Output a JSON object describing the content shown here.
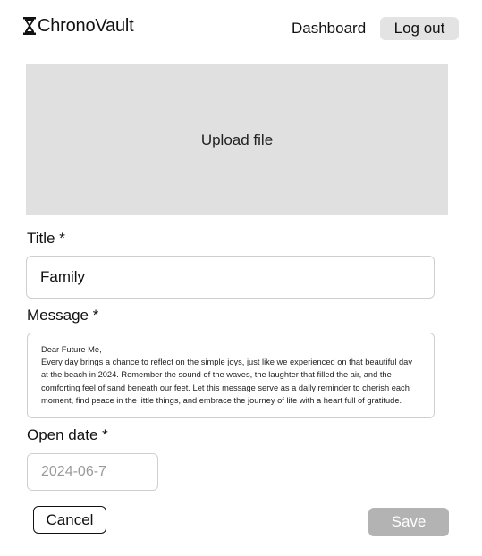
{
  "header": {
    "logo_icon": "hourglass-icon",
    "app_name": "ChronoVault",
    "nav": {
      "dashboard_label": "Dashboard",
      "logout_label": "Log out"
    }
  },
  "upload": {
    "label": "Upload file"
  },
  "form": {
    "title": {
      "label": "Title *",
      "value": "Family"
    },
    "message": {
      "label": "Message *",
      "lines": [
        "Dear Future Me,",
        "Every day brings a chance to reflect on the simple joys, just like we experienced on that beautiful day",
        "at the beach in 2024. Remember the sound of the waves, the laughter that filled the air, and the",
        "comforting feel of sand beneath our feet. Let this message serve as a daily reminder to cherish each",
        "moment, find peace in the little things, and embrace the journey of life with a heart full of gratitude."
      ]
    },
    "open_date": {
      "label": "Open date *",
      "placeholder": "2024-06-7"
    }
  },
  "actions": {
    "cancel_label": "Cancel",
    "save_label": "Save"
  },
  "colors": {
    "upload_bg": "#e0e0e0",
    "logout_bg": "#e3e3e3",
    "save_disabled_bg": "#b3b3b3",
    "border": "#cfcfcf",
    "text": "#111111"
  }
}
